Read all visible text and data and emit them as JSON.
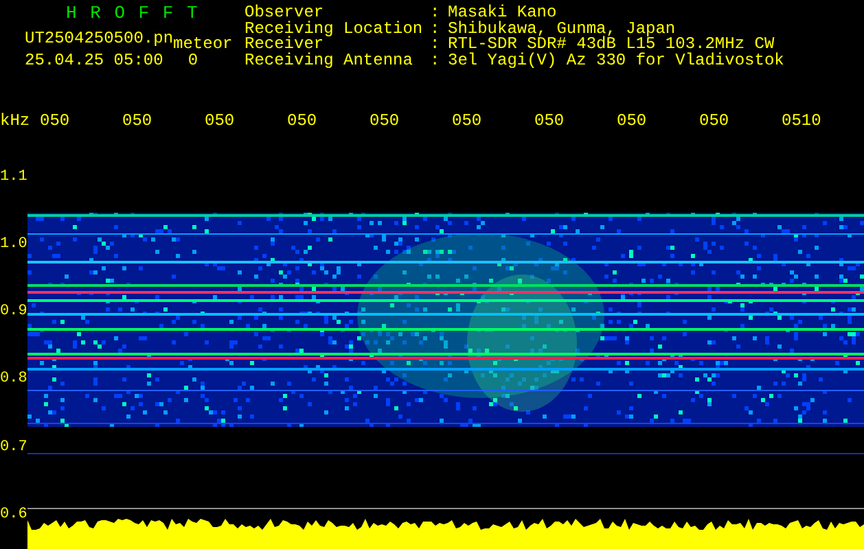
{
  "header": {
    "title": "H R O F F T",
    "file_name": "UT2504250500.pn",
    "tag": "meteor",
    "date_time": "25.04.25 05:00",
    "field": "0"
  },
  "info": [
    {
      "label": "Observer",
      "separator": ":",
      "value": "Masaki Kano"
    },
    {
      "label": "Receiving Location",
      "separator": ":",
      "value": "Shibukawa, Gunma, Japan"
    },
    {
      "label": "Receiver",
      "separator": ":",
      "value": "RTL-SDR SDR# 43dB L15 103.2MHz CW"
    },
    {
      "label": "Receiving Antenna",
      "separator": ":",
      "value": "3el Yagi(V) Az 330 for Vladivostok"
    }
  ],
  "time_labels": [
    "050",
    "050",
    "050",
    "050",
    "050",
    "050",
    "050",
    "050",
    "050",
    "0510"
  ],
  "y_axis": {
    "unit": "kHz",
    "ticks": [
      "1.1",
      "1.0",
      "0.9",
      "0.8",
      "0.7",
      "0.6"
    ]
  }
}
